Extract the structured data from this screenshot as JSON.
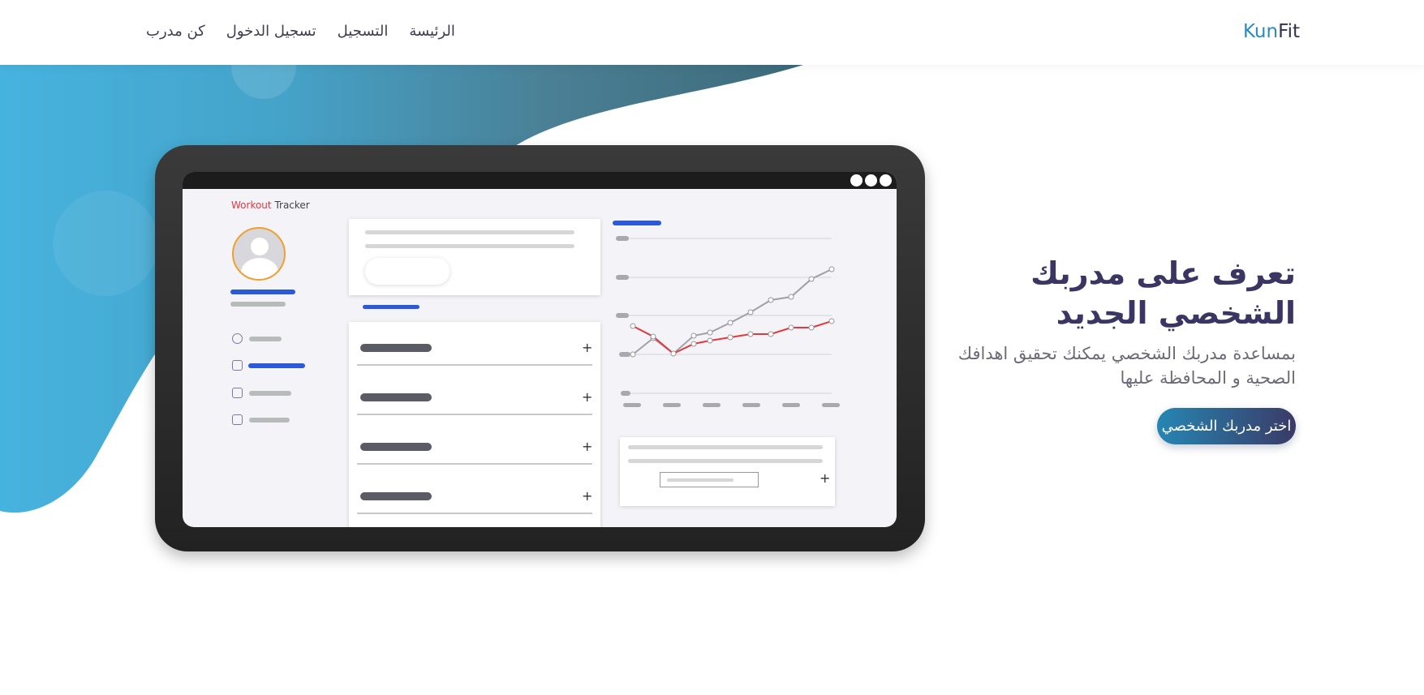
{
  "brand": {
    "part1": "Kun",
    "part2": "Fit"
  },
  "nav": {
    "links": [
      "الرئيسة",
      "التسجيل",
      "تسجيل الدخول",
      "كن مدرب"
    ]
  },
  "hero": {
    "title": "تعرف على مدربك الشخصي الجديد",
    "subtitle": "بمساعدة مدربك الشخصي يمكنك تحقيق اهدافك الصحية و المحافظة عليها",
    "cta_label": "اختر مدربك الشخصي"
  },
  "mockup": {
    "app_title_part1": "Workout",
    "app_title_part2": "Tracker"
  },
  "colors": {
    "brand_blue": "#2b8cb8",
    "dark_navy": "#2f3250",
    "blob_start": "#3fb0dc",
    "blob_end": "#3a6e84",
    "accent_red": "#e0393e"
  }
}
